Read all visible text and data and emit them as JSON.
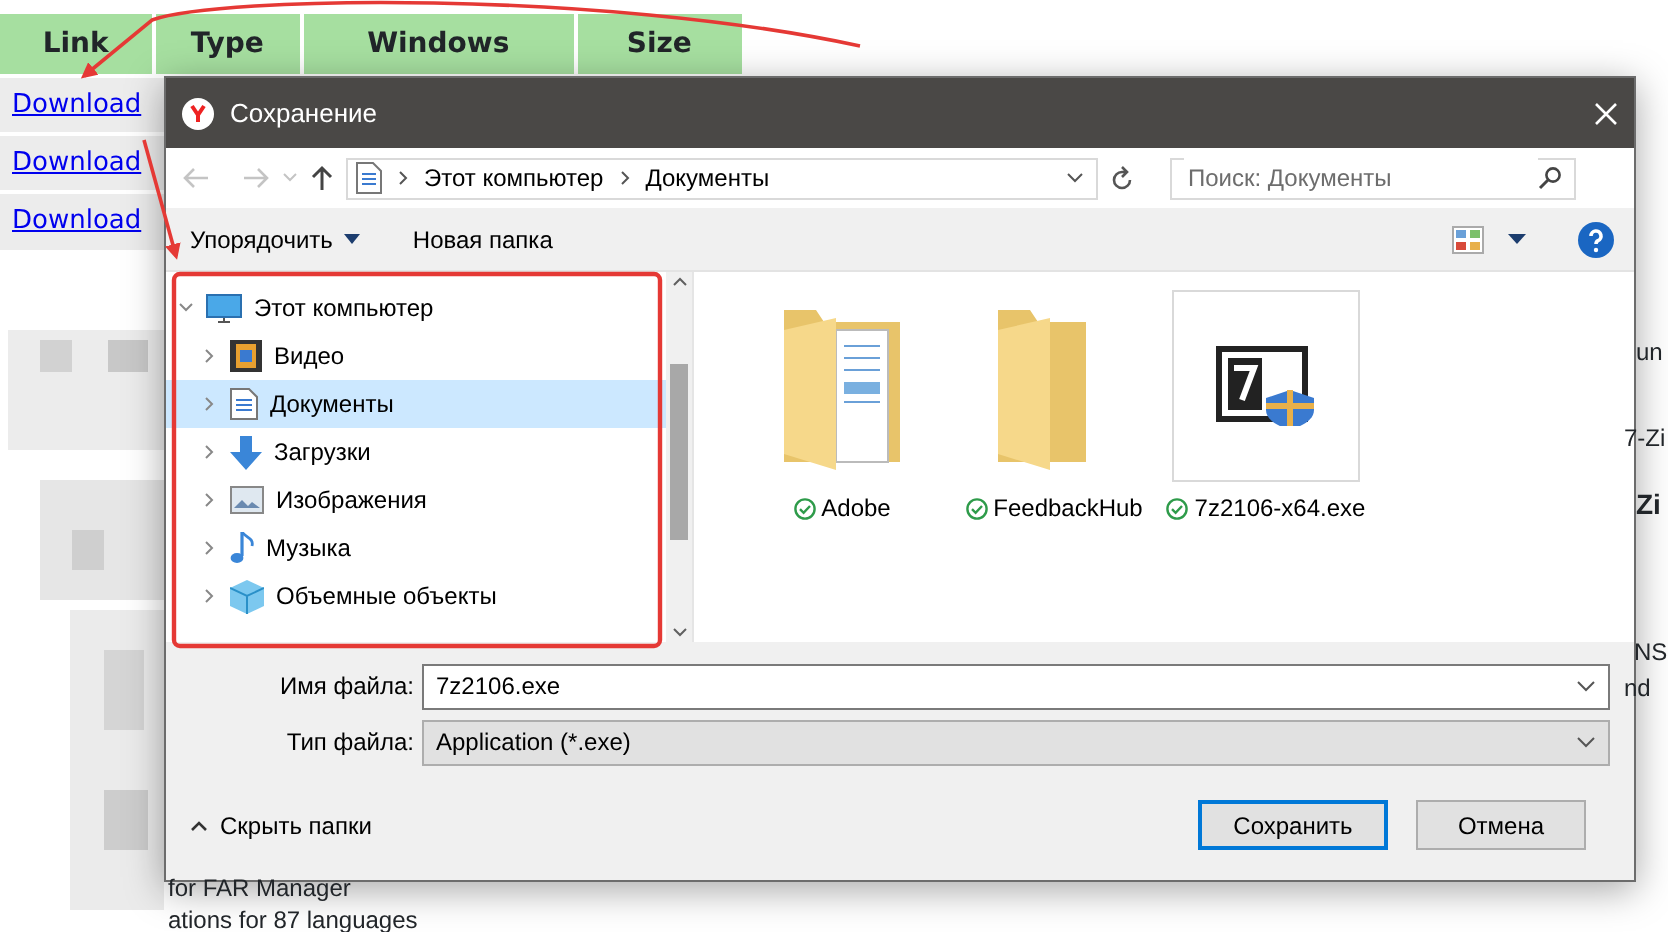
{
  "page_table": {
    "columns": [
      "Link",
      "Type",
      "Windows",
      "Size"
    ],
    "rows": [
      {
        "link": "Download"
      },
      {
        "link": "Download"
      },
      {
        "link": "Download"
      }
    ]
  },
  "page_text": [
    {
      "text": "un",
      "kind": "plain"
    },
    {
      "text": "7-Zi",
      "kind": "plain"
    },
    {
      "text": "Zi",
      "kind": "heading"
    },
    {
      "text": "NS",
      "kind": "plain"
    },
    {
      "text": "nd",
      "kind": "plain"
    },
    {
      "text": "for FAR Manager",
      "kind": "plain"
    },
    {
      "text": "ations for 87 languages",
      "kind": "plain"
    }
  ],
  "dialog": {
    "title": "Сохранение",
    "address": [
      "Этот компьютер",
      "Документы"
    ],
    "search": {
      "placeholder": "Поиск: Документы"
    },
    "toolbar": {
      "organize": "Упорядочить",
      "new_folder": "Новая папка"
    },
    "tree": {
      "label": "Этот компьютер",
      "kind": "computer",
      "expanded": true,
      "selected": false,
      "children": [
        {
          "label": "Видео",
          "kind": "video",
          "expanded": false,
          "selected": false
        },
        {
          "label": "Документы",
          "kind": "documents",
          "expanded": false,
          "selected": true
        },
        {
          "label": "Загрузки",
          "kind": "downloads",
          "expanded": false,
          "selected": false
        },
        {
          "label": "Изображения",
          "kind": "pictures",
          "expanded": false,
          "selected": false
        },
        {
          "label": "Музыка",
          "kind": "music",
          "expanded": false,
          "selected": false
        },
        {
          "label": "Объемные объекты",
          "kind": "objects",
          "expanded": false,
          "selected": false
        }
      ]
    },
    "files": [
      {
        "name": "Adobe",
        "kind": "folder-docs",
        "selected": false
      },
      {
        "name": "FeedbackHub",
        "kind": "folder",
        "selected": false
      },
      {
        "name": "7z2106-x64.exe",
        "kind": "app",
        "selected": true
      }
    ],
    "file_name": {
      "label": "Имя файла:",
      "value": "7z2106.exe"
    },
    "file_type": {
      "label": "Тип файла:",
      "value": "Application (*.exe)"
    },
    "hide_folders": "Скрыть папки",
    "buttons": [
      {
        "label": "Сохранить",
        "default": true
      },
      {
        "label": "Отмена",
        "default": false
      }
    ]
  }
}
